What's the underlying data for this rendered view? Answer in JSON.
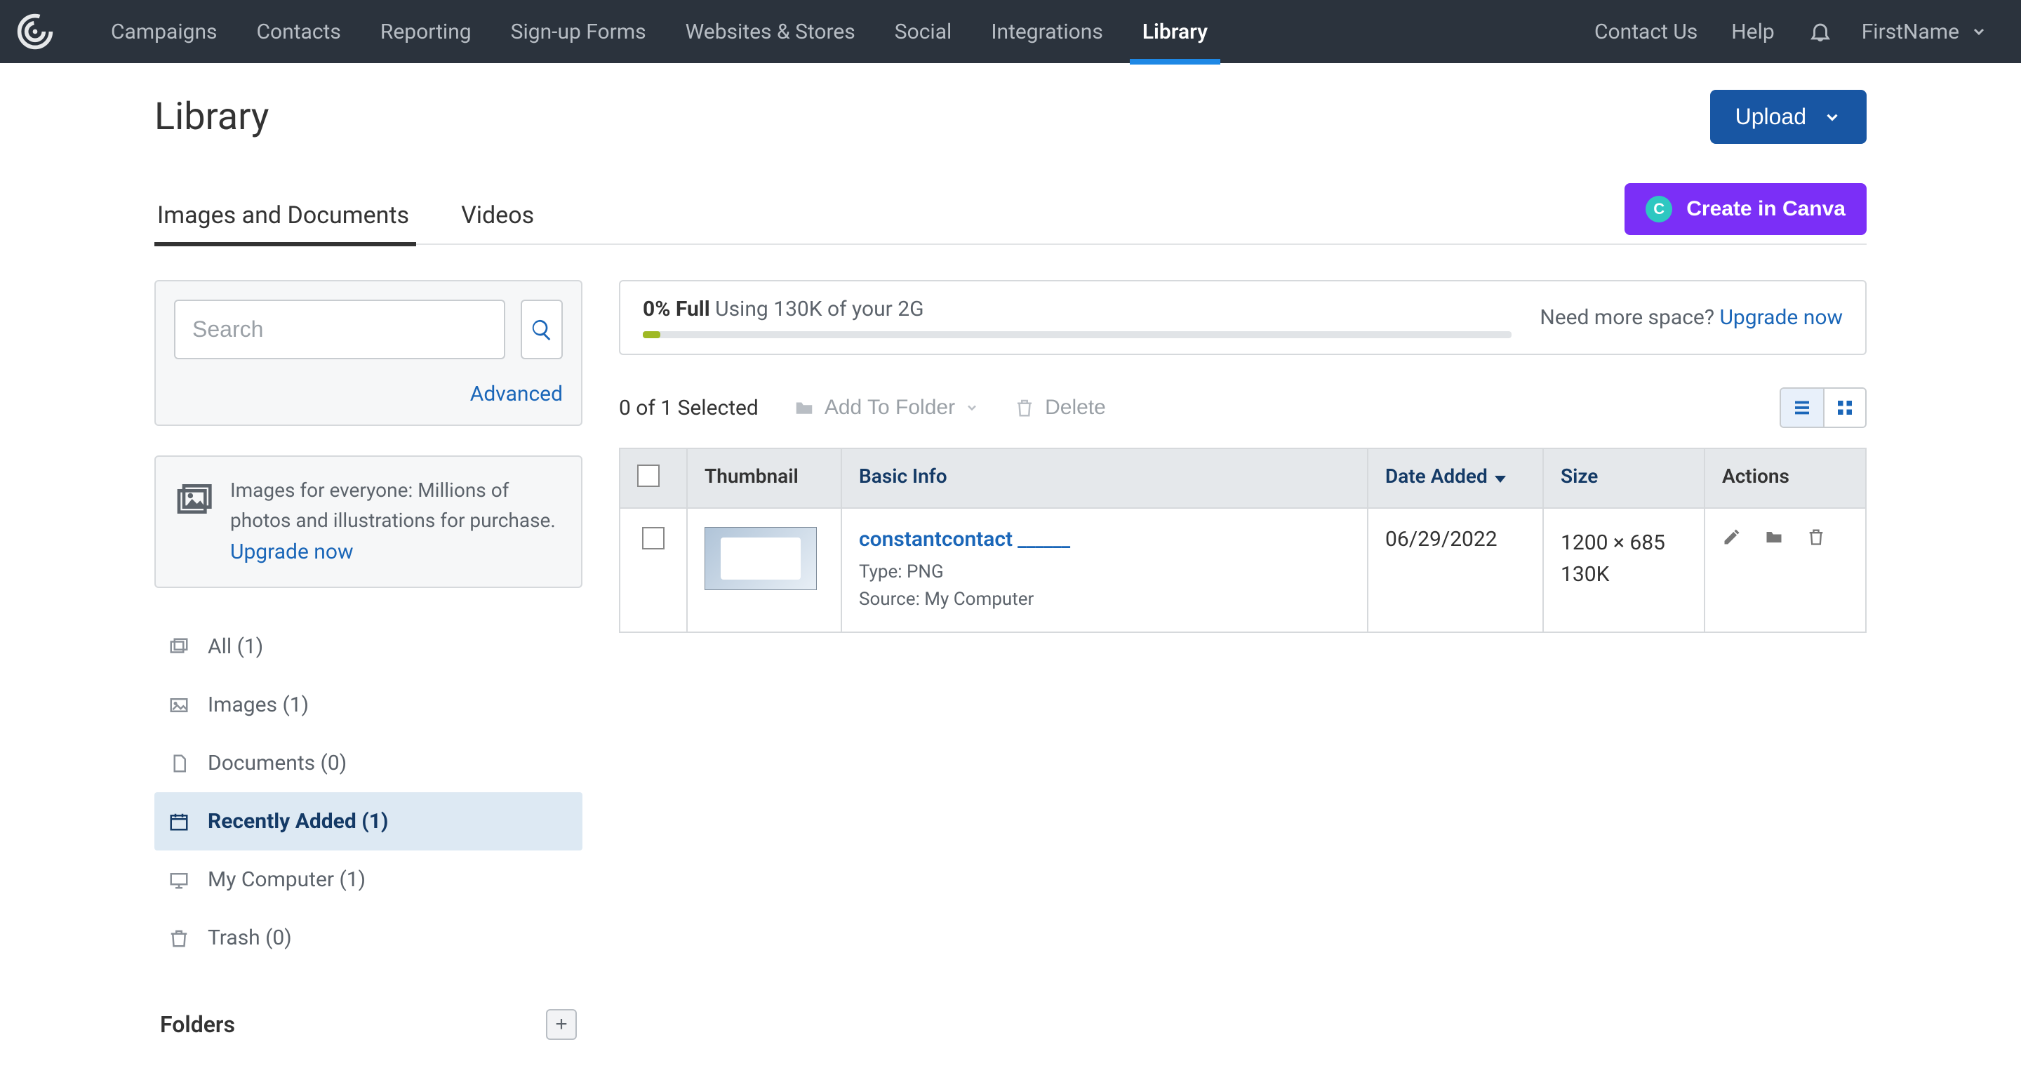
{
  "nav": {
    "items": [
      "Campaigns",
      "Contacts",
      "Reporting",
      "Sign-up Forms",
      "Websites & Stores",
      "Social",
      "Integrations",
      "Library"
    ],
    "active_index": 7,
    "right": {
      "contact": "Contact Us",
      "help": "Help",
      "user": "FirstName"
    }
  },
  "page": {
    "title": "Library",
    "upload_btn": "Upload",
    "tabs": [
      "Images and Documents",
      "Videos"
    ],
    "active_tab": 0,
    "canva_btn": "Create in Canva",
    "canva_badge": "C"
  },
  "sidebar": {
    "search_placeholder": "Search",
    "advanced_link": "Advanced",
    "promo_text": "Images for everyone: Millions of photos and illustrations for purchase. ",
    "promo_link": "Upgrade now",
    "folders": [
      {
        "label": "All (1)",
        "icon": "copyview"
      },
      {
        "label": "Images (1)",
        "icon": "images"
      },
      {
        "label": "Documents (0)",
        "icon": "doc"
      },
      {
        "label": "Recently Added (1)",
        "icon": "calendar",
        "active": true
      },
      {
        "label": "My Computer (1)",
        "icon": "monitor"
      },
      {
        "label": "Trash (0)",
        "icon": "trash"
      }
    ],
    "folders_heading": "Folders"
  },
  "storage": {
    "percent_label": "0% Full",
    "usage_text": "Using 130K of your 2G",
    "need_more": "Need more space?",
    "upgrade_link": "Upgrade now"
  },
  "toolbar": {
    "selected_text": "0 of 1 Selected",
    "add_folder": "Add To Folder",
    "delete": "Delete"
  },
  "table": {
    "headers": {
      "thumbnail": "Thumbnail",
      "basic_info": "Basic Info",
      "date_added": "Date Added",
      "size": "Size",
      "actions": "Actions"
    },
    "rows": [
      {
        "name": "constantcontact",
        "name_suffix": "______",
        "type_line": "Type: PNG",
        "source_line": "Source: My Computer",
        "date": "06/29/2022",
        "dims": "1200 × 685",
        "size": "130K"
      }
    ]
  }
}
